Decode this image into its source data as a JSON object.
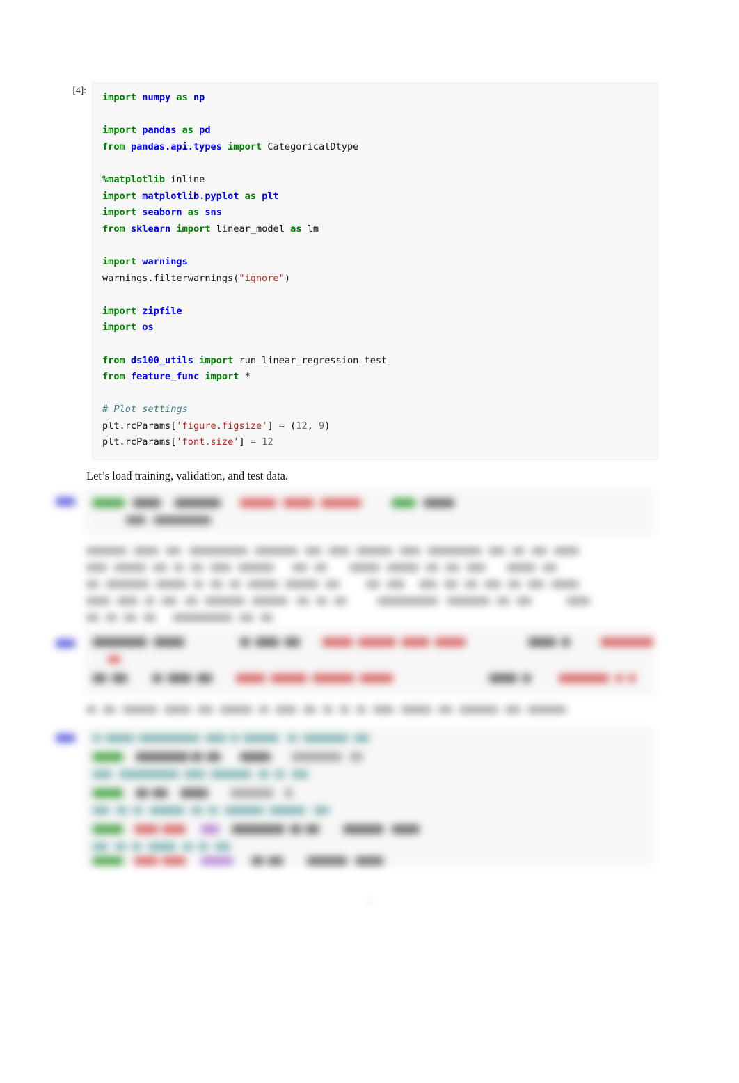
{
  "document": {
    "type": "jupyter-notebook-pdf-export",
    "page_number": "1",
    "background_color": "#ffffff",
    "cell_background_color": "#f7f7f7"
  },
  "cells": [
    {
      "id": "code-cell-1",
      "prompt": "[4]:",
      "state": "legible",
      "lines": [
        [
          {
            "t": "import",
            "c": "k"
          },
          {
            "t": " ",
            "c": "o"
          },
          {
            "t": "numpy",
            "c": "nn"
          },
          {
            "t": " ",
            "c": "o"
          },
          {
            "t": "as",
            "c": "k"
          },
          {
            "t": " ",
            "c": "o"
          },
          {
            "t": "np",
            "c": "nn"
          }
        ],
        [],
        [
          {
            "t": "import",
            "c": "k"
          },
          {
            "t": " ",
            "c": "o"
          },
          {
            "t": "pandas",
            "c": "nn"
          },
          {
            "t": " ",
            "c": "o"
          },
          {
            "t": "as",
            "c": "k"
          },
          {
            "t": " ",
            "c": "o"
          },
          {
            "t": "pd",
            "c": "nn"
          }
        ],
        [
          {
            "t": "from",
            "c": "k"
          },
          {
            "t": " ",
            "c": "o"
          },
          {
            "t": "pandas.api.types",
            "c": "nn"
          },
          {
            "t": " ",
            "c": "o"
          },
          {
            "t": "import",
            "c": "k"
          },
          {
            "t": " ",
            "c": "o"
          },
          {
            "t": "CategoricalDtype",
            "c": "n"
          }
        ],
        [],
        [
          {
            "t": "%matplotlib",
            "c": "mg"
          },
          {
            "t": " inline",
            "c": "n"
          }
        ],
        [
          {
            "t": "import",
            "c": "k"
          },
          {
            "t": " ",
            "c": "o"
          },
          {
            "t": "matplotlib.pyplot",
            "c": "nn"
          },
          {
            "t": " ",
            "c": "o"
          },
          {
            "t": "as",
            "c": "k"
          },
          {
            "t": " ",
            "c": "o"
          },
          {
            "t": "plt",
            "c": "nn"
          }
        ],
        [
          {
            "t": "import",
            "c": "k"
          },
          {
            "t": " ",
            "c": "o"
          },
          {
            "t": "seaborn",
            "c": "nn"
          },
          {
            "t": " ",
            "c": "o"
          },
          {
            "t": "as",
            "c": "k"
          },
          {
            "t": " ",
            "c": "o"
          },
          {
            "t": "sns",
            "c": "nn"
          }
        ],
        [
          {
            "t": "from",
            "c": "k"
          },
          {
            "t": " ",
            "c": "o"
          },
          {
            "t": "sklearn",
            "c": "nn"
          },
          {
            "t": " ",
            "c": "o"
          },
          {
            "t": "import",
            "c": "k"
          },
          {
            "t": " ",
            "c": "o"
          },
          {
            "t": "linear_model",
            "c": "n"
          },
          {
            "t": " ",
            "c": "o"
          },
          {
            "t": "as",
            "c": "k"
          },
          {
            "t": " ",
            "c": "o"
          },
          {
            "t": "lm",
            "c": "n"
          }
        ],
        [],
        [
          {
            "t": "import",
            "c": "k"
          },
          {
            "t": " ",
            "c": "o"
          },
          {
            "t": "warnings",
            "c": "nn"
          }
        ],
        [
          {
            "t": "warnings.filterwarnings(",
            "c": "n"
          },
          {
            "t": "\"ignore\"",
            "c": "s"
          },
          {
            "t": ")",
            "c": "n"
          }
        ],
        [],
        [
          {
            "t": "import",
            "c": "k"
          },
          {
            "t": " ",
            "c": "o"
          },
          {
            "t": "zipfile",
            "c": "nn"
          }
        ],
        [
          {
            "t": "import",
            "c": "k"
          },
          {
            "t": " ",
            "c": "o"
          },
          {
            "t": "os",
            "c": "nn"
          }
        ],
        [],
        [
          {
            "t": "from",
            "c": "k"
          },
          {
            "t": " ",
            "c": "o"
          },
          {
            "t": "ds100_utils",
            "c": "nn"
          },
          {
            "t": " ",
            "c": "o"
          },
          {
            "t": "import",
            "c": "k"
          },
          {
            "t": " ",
            "c": "o"
          },
          {
            "t": "run_linear_regression_test",
            "c": "n"
          }
        ],
        [
          {
            "t": "from",
            "c": "k"
          },
          {
            "t": " ",
            "c": "o"
          },
          {
            "t": "feature_func",
            "c": "nn"
          },
          {
            "t": " ",
            "c": "o"
          },
          {
            "t": "import",
            "c": "k"
          },
          {
            "t": " ",
            "c": "o"
          },
          {
            "t": "*",
            "c": "o"
          }
        ],
        [],
        [
          {
            "t": "# Plot settings",
            "c": "c"
          }
        ],
        [
          {
            "t": "plt.rcParams[",
            "c": "n"
          },
          {
            "t": "'figure.figsize'",
            "c": "s"
          },
          {
            "t": "] = (",
            "c": "n"
          },
          {
            "t": "12",
            "c": "mi"
          },
          {
            "t": ", ",
            "c": "n"
          },
          {
            "t": "9",
            "c": "mi"
          },
          {
            "t": ")",
            "c": "n"
          }
        ],
        [
          {
            "t": "plt.rcParams[",
            "c": "n"
          },
          {
            "t": "'font.size'",
            "c": "s"
          },
          {
            "t": "] = ",
            "c": "n"
          },
          {
            "t": "12",
            "c": "mi"
          }
        ]
      ]
    }
  ],
  "prose": [
    {
      "id": "markdown-1",
      "state": "legible",
      "text": "Let’s load training, validation, and test data."
    },
    {
      "id": "markdown-2",
      "state": "blurred",
      "text": ""
    },
    {
      "id": "markdown-3",
      "state": "blurred",
      "text": ""
    }
  ],
  "redacted": {
    "note": "Content below the first markdown line is blurred and unreadable in the source screenshot.",
    "cell_2": {
      "prompt_state": "blurred",
      "lines": 2
    },
    "cell_3": {
      "prompt_state": "blurred",
      "lines": 2
    },
    "cell_4": {
      "prompt_state": "blurred",
      "lines": 9
    }
  }
}
